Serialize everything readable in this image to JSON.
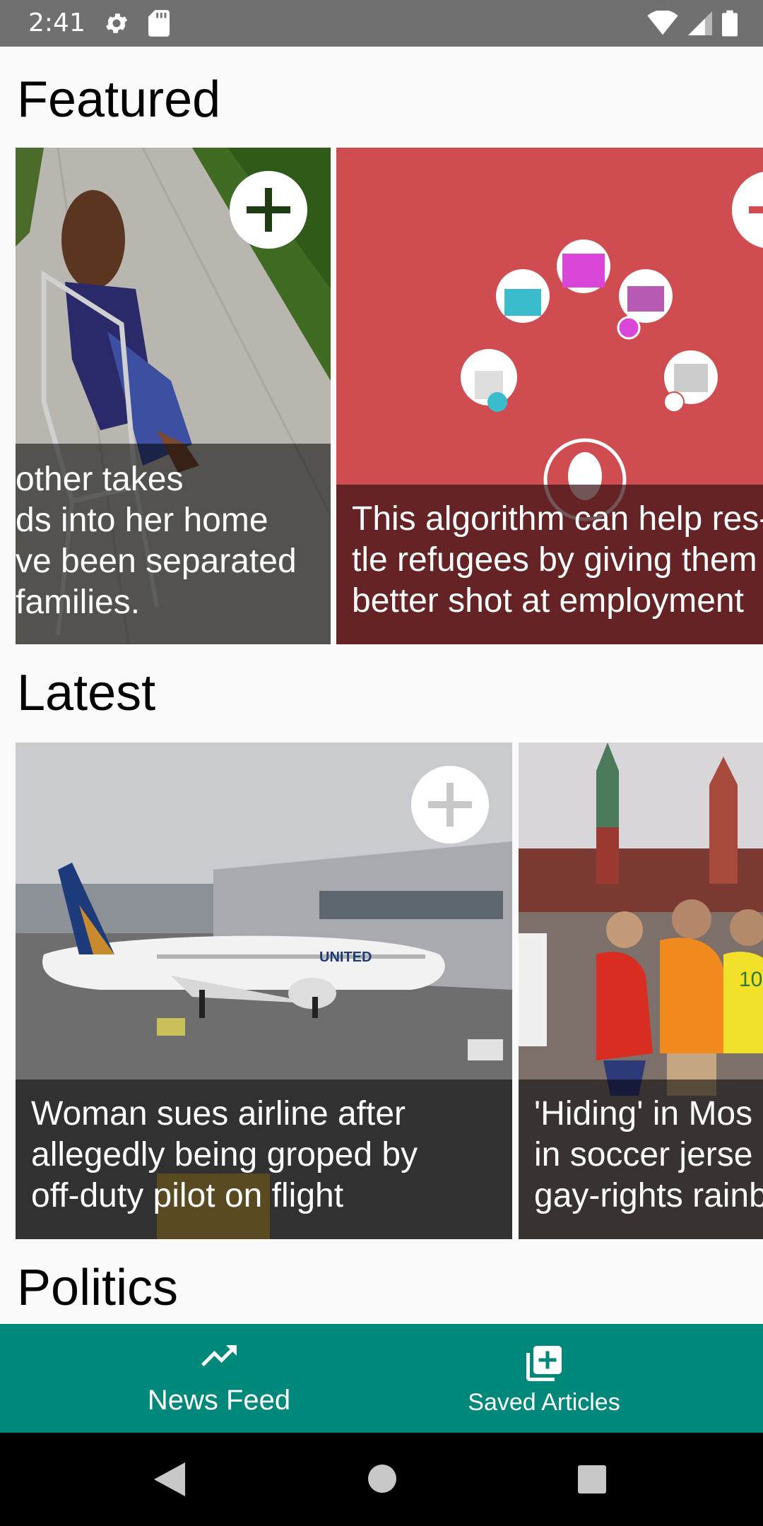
{
  "status_bar": {
    "time": "2:41"
  },
  "sections": {
    "featured": {
      "title": "Featured",
      "cards": [
        {
          "caption_lines": [
            "other takes",
            "ds into her home",
            "ve been separated",
            "families."
          ]
        },
        {
          "caption_lines": [
            "This algorithm can help res-",
            "tle refugees by giving them",
            "better shot at employment"
          ]
        }
      ]
    },
    "latest": {
      "title": "Latest",
      "cards": [
        {
          "caption_lines": [
            "Woman sues airline after",
            "allegedly being groped by",
            "off-duty pilot on flight"
          ],
          "plane_text": "UNITED"
        },
        {
          "caption_lines": [
            "'Hiding' in Mos",
            "in soccer jerse",
            "gay-rights rainb"
          ],
          "jersey_number": "10"
        }
      ]
    },
    "politics": {
      "title": "Politics"
    }
  },
  "bottom_nav": {
    "items": [
      {
        "label": "News Feed",
        "icon": "trending-up-icon"
      },
      {
        "label": "Saved Articles",
        "icon": "library-add-icon"
      }
    ]
  },
  "colors": {
    "accent": "#00897b",
    "featured_card_2_bg": "#cf4c51",
    "status_bar": "#707070"
  }
}
